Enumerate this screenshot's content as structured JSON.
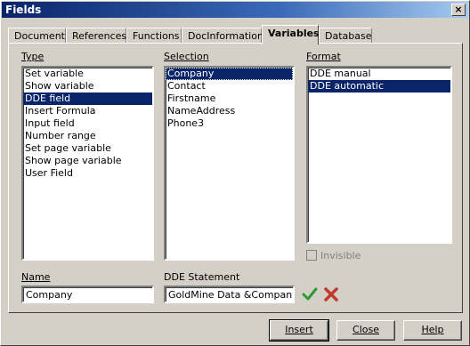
{
  "window": {
    "title": "Fields",
    "close_glyph": "×"
  },
  "tabs": [
    {
      "label": "Document"
    },
    {
      "label": "References"
    },
    {
      "label": "Functions"
    },
    {
      "label": "DocInformation"
    },
    {
      "label": "Variables"
    },
    {
      "label": "Database"
    }
  ],
  "type_list": {
    "label": "Type",
    "items": [
      "Set variable",
      "Show variable",
      "DDE field",
      "Insert Formula",
      "Input field",
      "Number range",
      "Set page variable",
      "Show page variable",
      "User Field"
    ],
    "selected": "DDE field"
  },
  "selection_list": {
    "label": "Selection",
    "items": [
      "Company",
      "Contact",
      "Firstname",
      "NameAddress",
      "Phone3"
    ],
    "selected": "Company"
  },
  "format_list": {
    "label": "Format",
    "items": [
      "DDE manual",
      "DDE automatic"
    ],
    "selected": "DDE automatic"
  },
  "invisible_checkbox": {
    "label": "Invisible",
    "checked": false
  },
  "name_field": {
    "label": "Name",
    "value": "Company"
  },
  "dde_statement": {
    "label": "DDE Statement",
    "value": "GoldMine Data &Company"
  },
  "icons": {
    "apply": "check-icon",
    "cancel": "x-icon",
    "apply_color": "#2e9a2e",
    "cancel_color": "#c0392b"
  },
  "buttons": {
    "insert": "Insert",
    "close": "Close",
    "help": "Help"
  }
}
